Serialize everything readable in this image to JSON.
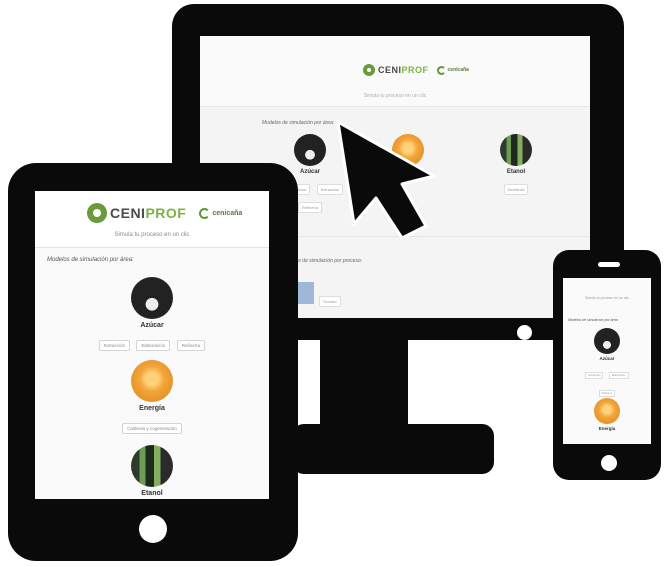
{
  "brand": {
    "name_part1": "CENI",
    "name_part2": "PROF",
    "partner": "cenicaña"
  },
  "subtitle": "Simula tu proceso en un clic",
  "section_areas": "Modelos de simulación por área:",
  "section_process": "Modelos de simulación por proceso:",
  "areas": [
    {
      "label": "Azúcar",
      "buttons": [
        "Extracción",
        "Elaboración",
        "Refinería"
      ]
    },
    {
      "label": "Energía",
      "buttons": [
        "Calderas y cogeneración"
      ]
    },
    {
      "label": "Etanol",
      "buttons": [
        "Destilería"
      ]
    }
  ],
  "monitor_areas_buttons": {
    "azucar": [
      "Elaboración",
      "Extracción"
    ],
    "azucar_row2": [
      "Refinería"
    ],
    "etanol": [
      "Destilería"
    ]
  },
  "process_button": "Secado",
  "phone_subtitle": "Simula tu proceso en un clic",
  "phone_section": "Modelos de simulación por área:"
}
